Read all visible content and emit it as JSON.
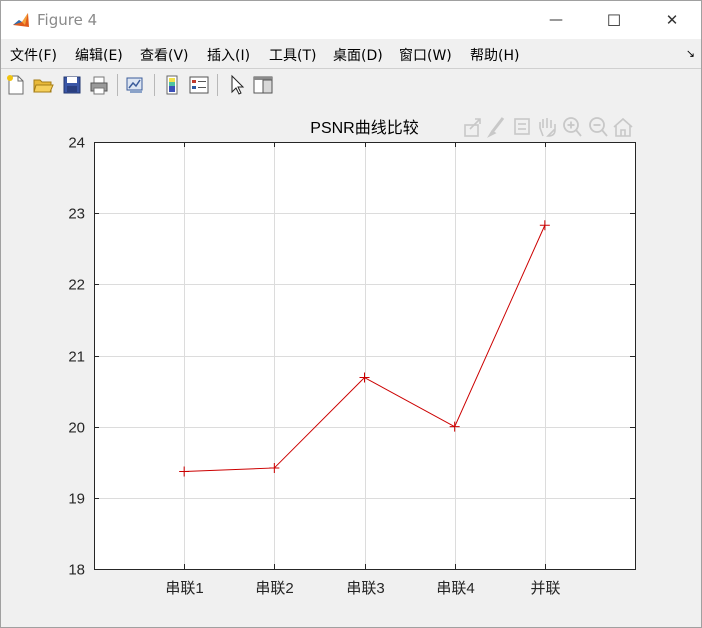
{
  "window": {
    "title": "Figure 4",
    "minimize_glyph": "—",
    "maximize_glyph": "☐",
    "close_glyph": "✕"
  },
  "menubar": {
    "items": [
      "文件(F)",
      "编辑(E)",
      "查看(V)",
      "插入(I)",
      "工具(T)",
      "桌面(D)",
      "窗口(W)",
      "帮助(H)"
    ],
    "overflow_glyph": "↘"
  },
  "toolbar": {
    "buttons": [
      "new-figure-icon",
      "open-file-icon",
      "save-icon",
      "print-icon",
      "link-plot-icon",
      "colorbar-icon",
      "legend-icon",
      "pointer-icon",
      "property-editor-icon"
    ]
  },
  "axes_toolbar": {
    "buttons": [
      "export-icon",
      "brush-icon",
      "data-tips-icon",
      "pan-icon",
      "zoom-in-icon",
      "zoom-out-icon",
      "home-icon"
    ]
  },
  "chart_data": {
    "type": "line",
    "title": "PSNR曲线比较",
    "xlabel": "",
    "ylabel": "",
    "categories": [
      "串联1",
      "串联2",
      "串联3",
      "串联4",
      "并联"
    ],
    "series": [
      {
        "values": [
          19.37,
          19.42,
          20.69,
          20.0,
          22.83
        ],
        "color": "#cc0000",
        "marker": "+"
      }
    ],
    "ylim": [
      18,
      24
    ],
    "yticks": [
      18,
      19,
      20,
      21,
      22,
      23,
      24
    ],
    "xlim": [
      0,
      6
    ],
    "grid": true
  }
}
